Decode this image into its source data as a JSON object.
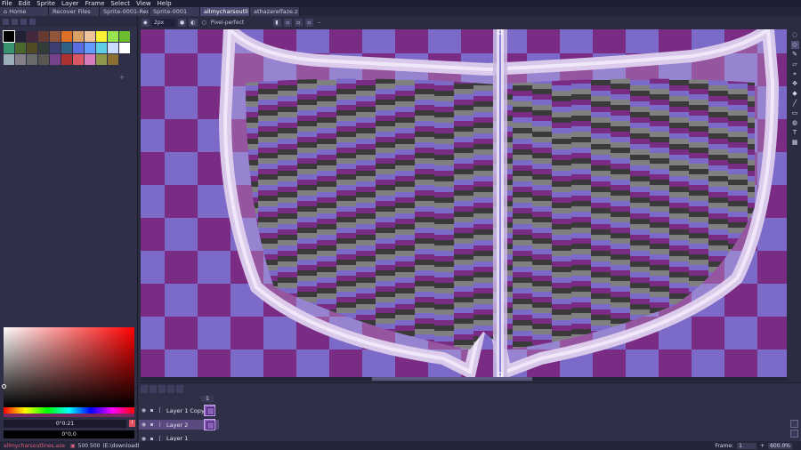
{
  "menu": [
    "File",
    "Edit",
    "Sprite",
    "Layer",
    "Frame",
    "Select",
    "View",
    "Help"
  ],
  "tabs": [
    {
      "label": "Home",
      "active": false,
      "closable": false
    },
    {
      "label": "Recover Files",
      "active": false,
      "closable": false
    },
    {
      "label": "Sprite-0001-Rec",
      "active": false,
      "closable": false
    },
    {
      "label": "Sprite-0001",
      "active": false,
      "closable": false
    },
    {
      "label": "allmycharsoutli",
      "active": true,
      "closable": true
    },
    {
      "label": "athazarelfaze.z",
      "active": false,
      "closable": true
    }
  ],
  "palette": [
    "#000000",
    "#222034",
    "#45283c",
    "#663931",
    "#8f563b",
    "#df7126",
    "#d9a066",
    "#eec39a",
    "#fbf236",
    "#99e550",
    "#6abe30",
    "#37946e",
    "#4b692f",
    "#524b24",
    "#323c39",
    "#3f3f74",
    "#306082",
    "#5b6ee1",
    "#639bff",
    "#5fcde4",
    "#cbdbfc",
    "#ffffff",
    "#9badb7",
    "#847e87",
    "#696a6a",
    "#595652",
    "#76428a",
    "#ac3232",
    "#d95763",
    "#d77bba",
    "#8f974a",
    "#8a6f30"
  ],
  "context_bar": {
    "brush_size": "2px",
    "pixel_perfect": "Pixel-perfect"
  },
  "color": {
    "hex_top": "0°0:21",
    "hex_bottom": "0°0,0"
  },
  "timeline": {
    "frame_header": "1",
    "layers": [
      {
        "name": "Layer 1 Copy",
        "active": false
      },
      {
        "name": "Layer 2",
        "active": true
      },
      {
        "name": "Layer 1",
        "active": false
      }
    ]
  },
  "status": {
    "filename": "allmycharsoutlines.aze",
    "size": "500 500",
    "path": "(E:\\downloadl",
    "frame_label": "Frame:",
    "frame_value": "1",
    "zoom": "600.0%"
  },
  "icons": {
    "tools": [
      "marquee-icon",
      "lasso-icon",
      "pencil-icon",
      "eraser-icon",
      "eyedropper-icon",
      "move-icon",
      "fill-icon",
      "line-icon",
      "rectangle-icon",
      "blur-icon",
      "text-icon",
      "grid-icon"
    ]
  },
  "accent_colors": {
    "checker_dark": "#7a2b84",
    "checker_light": "#7b6ac7",
    "outline": "#d8c8ea",
    "stripe_dark": "#3a3a3a",
    "stripe_gray": "#808080"
  }
}
